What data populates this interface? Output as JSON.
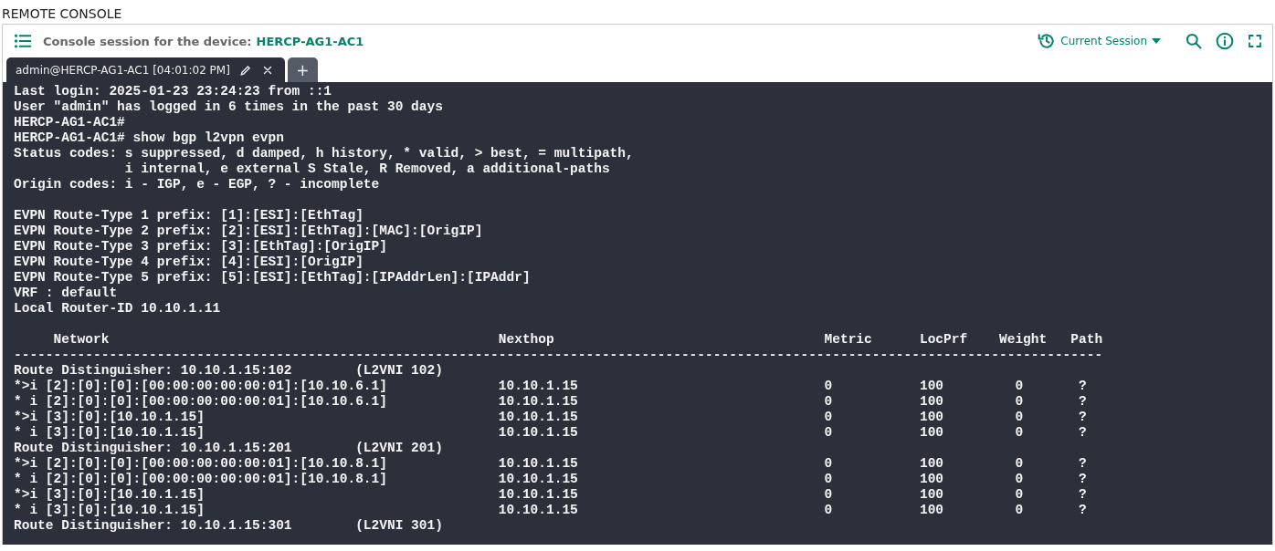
{
  "page_title": "REMOTE CONSOLE",
  "header": {
    "label": "Console session for the device:",
    "device": "HERCP-AG1-AC1",
    "session_dropdown": "Current Session"
  },
  "tabs": [
    {
      "label": "admin@HERCP-AG1-AC1 [04:01:02 PM]",
      "selected": true
    }
  ],
  "new_tab_button": "+",
  "terminal_blocks": [
    [
      "Last login: 2025-01-23 23:24:23 from ::1",
      "User \"admin\" has logged in 6 times in the past 30 days",
      "HERCP-AG1-AC1#",
      "HERCP-AG1-AC1# show bgp l2vpn evpn",
      "Status codes: s suppressed, d damped, h history, * valid, > best, = multipath,",
      "              i internal, e external S Stale, R Removed, a additional-paths",
      "Origin codes: i - IGP, e - EGP, ? - incomplete"
    ],
    [
      "EVPN Route-Type 1 prefix: [1]:[ESI]:[EthTag]",
      "EVPN Route-Type 2 prefix: [2]:[ESI]:[EthTag]:[MAC]:[OrigIP]",
      "EVPN Route-Type 3 prefix: [3]:[EthTag]:[OrigIP]",
      "EVPN Route-Type 4 prefix: [4]:[ESI]:[OrigIP]",
      "EVPN Route-Type 5 prefix: [5]:[ESI]:[EthTag]:[IPAddrLen]:[IPAddr]",
      "VRF : default",
      "Local Router-ID 10.10.1.11"
    ],
    [
      "     Network                                                 Nexthop                                  Metric      LocPrf    Weight   Path",
      "-----------------------------------------------------------------------------------------------------------------------------------------",
      "Route Distinguisher: 10.10.1.15:102        (L2VNI 102)",
      "*>i [2]:[0]:[0]:[00:00:00:00:00:01]:[10.10.6.1]              10.10.1.15                               0           100         0       ?",
      "* i [2]:[0]:[0]:[00:00:00:00:00:01]:[10.10.6.1]              10.10.1.15                               0           100         0       ?",
      "*>i [3]:[0]:[10.10.1.15]                                     10.10.1.15                               0           100         0       ?",
      "* i [3]:[0]:[10.10.1.15]                                     10.10.1.15                               0           100         0       ?",
      "Route Distinguisher: 10.10.1.15:201        (L2VNI 201)",
      "*>i [2]:[0]:[0]:[00:00:00:00:00:01]:[10.10.8.1]              10.10.1.15                               0           100         0       ?",
      "* i [2]:[0]:[0]:[00:00:00:00:00:01]:[10.10.8.1]              10.10.1.15                               0           100         0       ?",
      "*>i [3]:[0]:[10.10.1.15]                                     10.10.1.15                               0           100         0       ?",
      "* i [3]:[0]:[10.10.1.15]                                     10.10.1.15                               0           100         0       ?",
      "Route Distinguisher: 10.10.1.15:301        (L2VNI 301)"
    ]
  ]
}
